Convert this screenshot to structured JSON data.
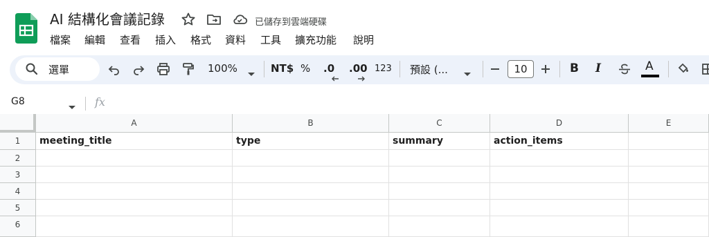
{
  "app": {
    "document_title": "AI 結構化會議記錄",
    "saved_status": "已儲存到雲端硬碟",
    "brand_color": "#0f9d58",
    "icons": [
      "star-icon",
      "move-to-folder-icon",
      "cloud-saved-icon"
    ]
  },
  "menu": [
    "檔案",
    "編輯",
    "查看",
    "插入",
    "格式",
    "資料",
    "工具",
    "擴充功能",
    "說明"
  ],
  "toolbar": {
    "search_label": "選單",
    "zoom": "100%",
    "currency": "NT$",
    "percent": "%",
    "decrease_decimal": ".0",
    "increase_decimal": ".00",
    "more_formats": "123",
    "font_name": "預設 (...",
    "font_size": "10",
    "bold": "B",
    "italic": "I",
    "text_color": "A"
  },
  "formula_bar": {
    "name_box": "G8",
    "fx_label": "fx",
    "value": ""
  },
  "sheet": {
    "columns": [
      "A",
      "B",
      "C",
      "D",
      "E"
    ],
    "rows": [
      "1",
      "2",
      "3",
      "4",
      "5",
      "6"
    ],
    "cells": {
      "A1": "meeting_title",
      "B1": "type",
      "C1": "summary",
      "D1": "action_items"
    }
  }
}
